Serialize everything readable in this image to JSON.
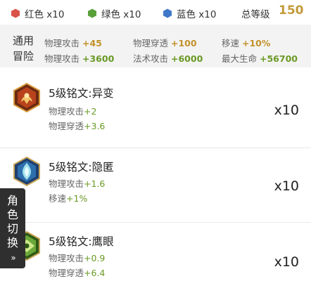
{
  "summary": {
    "red_label": "红色 x10",
    "green_label": "绿色 x10",
    "blue_label": "蓝色 x10",
    "total_label": "总等级",
    "total_value": "150",
    "colors": {
      "red": "#d9534a",
      "green": "#5aa03a",
      "blue": "#3f78c9",
      "gold": "#c39a3a"
    }
  },
  "stats": {
    "label_line1": "通用",
    "label_line2": "冒险",
    "rows": [
      [
        {
          "name": "物理攻击",
          "value": "+45"
        },
        {
          "name": "物理穿透",
          "value": "+100"
        },
        {
          "name": "移速",
          "value": "+10%"
        }
      ],
      [
        {
          "name": "物理攻击",
          "value": "+3600"
        },
        {
          "name": "法术攻击",
          "value": "+6000"
        },
        {
          "name": "最大生命",
          "value": "+56700"
        }
      ]
    ]
  },
  "runes": [
    {
      "name": "5级铭文:异变",
      "icon": "red-rune-icon",
      "lines": [
        {
          "name": "物理攻击",
          "value": "+2"
        },
        {
          "name": "物理穿透",
          "value": "+3.6"
        }
      ],
      "count": "x10"
    },
    {
      "name": "5级铭文:隐匿",
      "icon": "blue-rune-icon",
      "lines": [
        {
          "name": "物理攻击",
          "value": "+1.6"
        },
        {
          "name": "移速",
          "value": "+1%"
        }
      ],
      "count": "x10"
    },
    {
      "name": "5级铭文:鹰眼",
      "icon": "green-rune-icon",
      "lines": [
        {
          "name": "物理攻击",
          "value": "+0.9"
        },
        {
          "name": "物理穿透",
          "value": "+6.4"
        }
      ],
      "count": "x10"
    }
  ],
  "side_tab": {
    "chars": [
      "角",
      "色",
      "切",
      "换"
    ],
    "arrow": "»"
  }
}
